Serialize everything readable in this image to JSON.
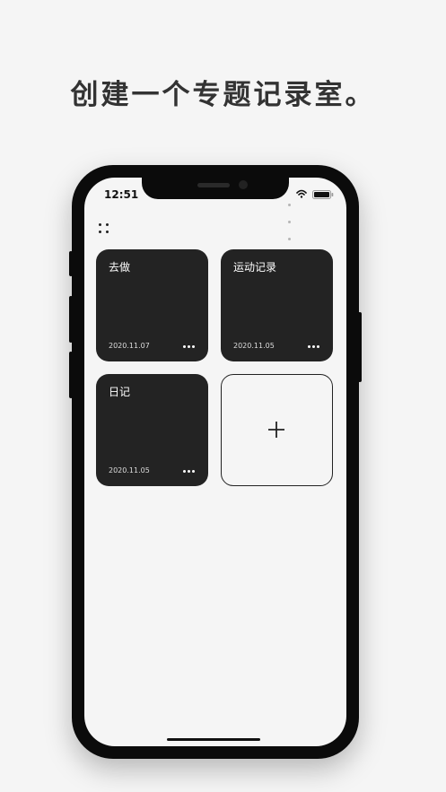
{
  "headline": "创建一个专题记录室。",
  "status_bar": {
    "time": "12:51"
  },
  "icons": {
    "menu": "four-dots-menu-icon",
    "more": "ellipsis-icon",
    "add": "plus-icon",
    "wifi": "wifi-icon",
    "battery": "battery-icon"
  },
  "cards": [
    {
      "title": "去做",
      "date": "2020.11.07"
    },
    {
      "title": "运动记录",
      "date": "2020.11.05"
    },
    {
      "title": "日记",
      "date": "2020.11.05"
    }
  ],
  "colors": {
    "background": "#f5f5f5",
    "card": "#232323",
    "phone_frame": "#0b0b0b"
  }
}
